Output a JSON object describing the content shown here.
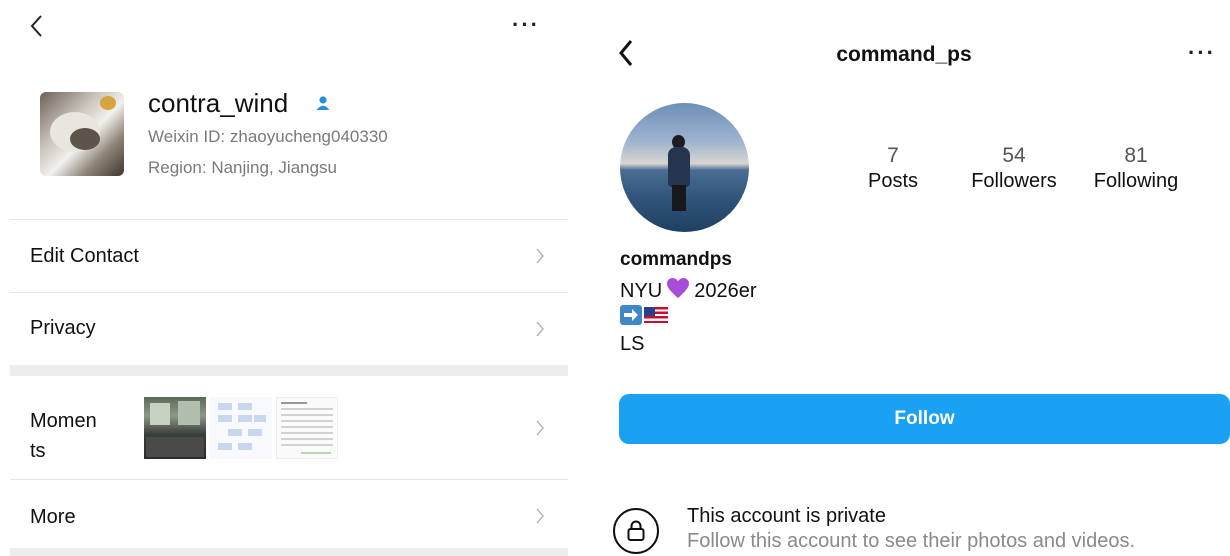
{
  "wechat": {
    "name": "contra_wind",
    "weixin_id": "Weixin ID: zhaoyucheng040330",
    "region": "Region: Nanjing, Jiangsu",
    "menu": {
      "edit_contact": "Edit Contact",
      "privacy": "Privacy",
      "moments_line1": "Momen",
      "moments_line2": "ts",
      "more": "More"
    },
    "more_glyph": "···",
    "accent_color": "#2b8fd6"
  },
  "instagram": {
    "username_header": "command_ps",
    "more_glyph": "···",
    "stats": [
      {
        "value": "7",
        "label": "Posts"
      },
      {
        "value": "54",
        "label": "Followers"
      },
      {
        "value": "81",
        "label": "Following"
      }
    ],
    "display_name": "commandps",
    "bio_line1_prefix": "NYU",
    "bio_line1_suffix": "2026er",
    "bio_line3": "LS",
    "follow_label": "Follow",
    "private_title": "This account is private",
    "private_subtitle": "Follow this account to see their photos and videos.",
    "follow_color": "#1aa1f3",
    "heart_color": "#a94cd9"
  }
}
